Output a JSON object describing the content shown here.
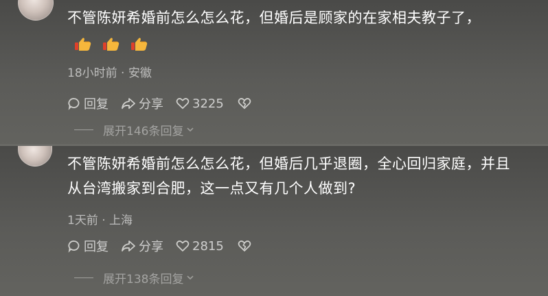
{
  "comments": [
    {
      "text": "不管陈妍希婚前怎么怎么花，但婚后是顾家的在家相夫教子了，",
      "emojis": [
        "thumbs-up-emoji",
        "thumbs-up-emoji",
        "thumbs-up-emoji"
      ],
      "time": "18小时前",
      "location": "安徽",
      "reply_label": "回复",
      "share_label": "分享",
      "like_count": "3225",
      "expand_label": "展开146条回复"
    },
    {
      "text": "不管陈妍希婚前怎么怎么花，但婚后几乎退圈，全心回归家庭，并且从台湾搬家到合肥，这一点又有几个人做到?",
      "emojis": [],
      "time": "1天前",
      "location": "上海",
      "reply_label": "回复",
      "share_label": "分享",
      "like_count": "2815",
      "expand_label": "展开138条回复"
    }
  ],
  "meta_separator": "·",
  "colors": {
    "background": "#5a5a57",
    "text": "#ffffff",
    "muted": "#b5b5b2"
  }
}
